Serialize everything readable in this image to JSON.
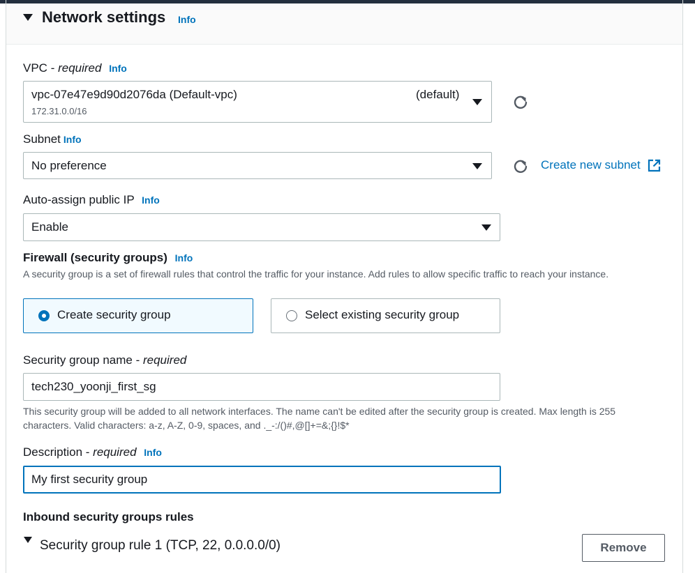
{
  "section": {
    "title": "Network settings",
    "info": "Info"
  },
  "vpc": {
    "label": "VPC",
    "required": "required",
    "info": "Info",
    "value": "vpc-07e47e9d90d2076da (Default-vpc)",
    "cidr": "172.31.0.0/16",
    "tag": "(default)"
  },
  "subnet": {
    "label": "Subnet",
    "info": "Info",
    "value": "No preference",
    "create_link": "Create new subnet"
  },
  "auto_ip": {
    "label": "Auto-assign public IP",
    "info": "Info",
    "value": "Enable"
  },
  "firewall": {
    "label": "Firewall (security groups)",
    "info": "Info",
    "description": "A security group is a set of firewall rules that control the traffic for your instance. Add rules to allow specific traffic to reach your instance.",
    "options": [
      {
        "label": "Create security group",
        "selected": true
      },
      {
        "label": "Select existing security group",
        "selected": false
      }
    ]
  },
  "sg_name": {
    "label": "Security group name",
    "required": "required",
    "value": "tech230_yoonji_first_sg",
    "help": "This security group will be added to all network interfaces. The name can't be edited after the security group is created. Max length is 255 characters. Valid characters: a-z, A-Z, 0-9, spaces, and ._-:/()#,@[]+=&;{}!$*"
  },
  "description": {
    "label": "Description",
    "required": "required",
    "info": "Info",
    "value": "My first security group"
  },
  "inbound": {
    "heading": "Inbound security groups rules",
    "rule_title": "Security group rule 1 (TCP, 22, 0.0.0.0/0)",
    "remove_button": "Remove"
  },
  "colors": {
    "accent": "#0073bb",
    "text": "#16191f",
    "muted": "#545b64",
    "border": "#aab7b8",
    "topbar": "#232f3e"
  },
  "icons": [
    "expand-caret-icon",
    "dropdown-caret-icon",
    "refresh-icon",
    "external-link-icon"
  ]
}
